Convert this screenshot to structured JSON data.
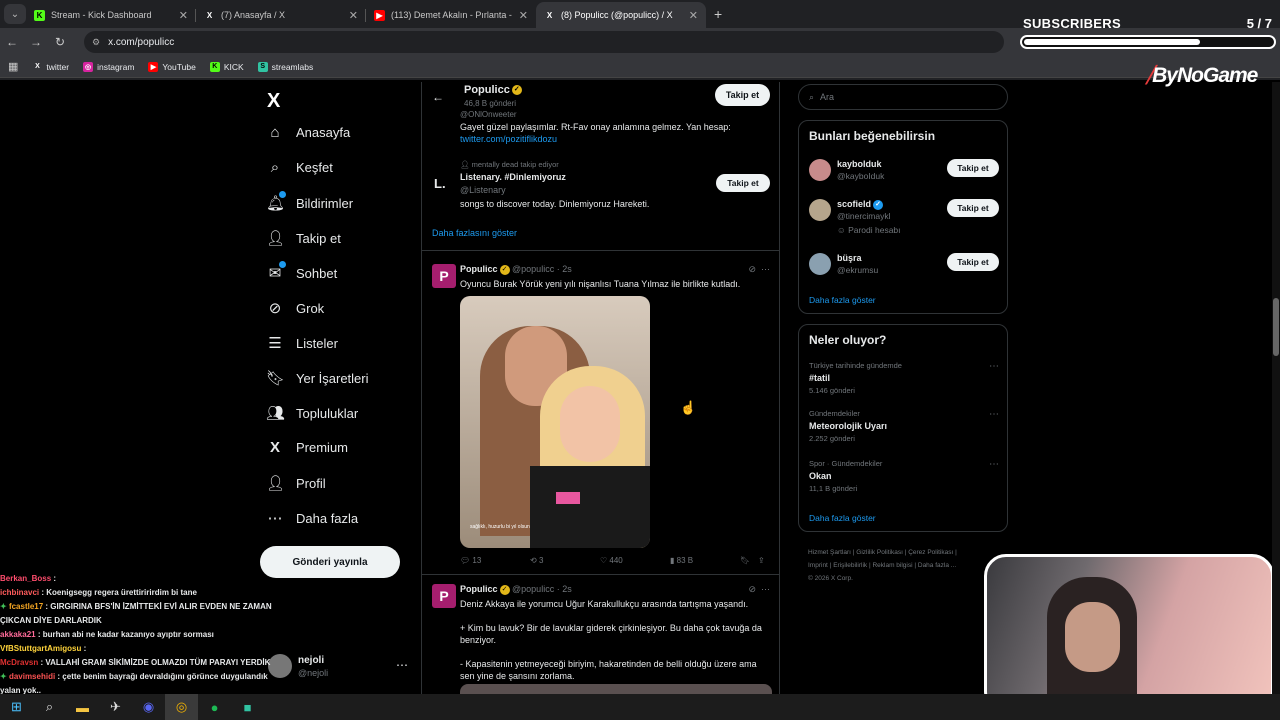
{
  "browser": {
    "tabs": [
      {
        "title": "Stream - Kick Dashboard",
        "icon": "kick-icon"
      },
      {
        "title": "(7) Anasayfa / X",
        "icon": "x-icon"
      },
      {
        "title": "(113) Demet Akalın - Pırlanta -",
        "icon": "youtube-icon"
      },
      {
        "title": "(8) Populicc (@populicc) / X",
        "icon": "x-icon",
        "active": true
      }
    ],
    "url": "x.com/populicc",
    "bookmarks": [
      "twitter",
      "instagram",
      "YouTube",
      "KICK",
      "streamlabs"
    ]
  },
  "overlay": {
    "subscribers_label": "SUBSCRIBERS",
    "subscribers_count": "5 / 7",
    "subscribers_progress": 0.71,
    "brand": "ByNoGame"
  },
  "sidebar": {
    "logo": "X",
    "items": [
      {
        "label": "Anasayfa",
        "icon": "home-icon"
      },
      {
        "label": "Keşfet",
        "icon": "search-icon"
      },
      {
        "label": "Bildirimler",
        "icon": "bell-icon"
      },
      {
        "label": "Takip et",
        "icon": "follow-icon"
      },
      {
        "label": "Sohbet",
        "icon": "mail-icon"
      },
      {
        "label": "Grok",
        "icon": "grok-icon"
      },
      {
        "label": "Listeler",
        "icon": "list-icon"
      },
      {
        "label": "Yer İşaretleri",
        "icon": "bookmark-icon"
      },
      {
        "label": "Topluluklar",
        "icon": "communities-icon"
      },
      {
        "label": "Premium",
        "icon": "x-icon"
      },
      {
        "label": "Profil",
        "icon": "profile-icon"
      },
      {
        "label": "Daha fazla",
        "icon": "more-icon"
      }
    ],
    "post_button": "Gönderi yayınla",
    "account": {
      "name": "nejoli",
      "handle": "@nejoli"
    }
  },
  "chat": [
    {
      "user": "Berkan_Boss",
      "text": ":",
      "color": "#ff4d6d"
    },
    {
      "user": "ichbinavci",
      "text": ": Koenigsegg regera ürettiririrdim bi tane",
      "color": "#ff5c5c"
    },
    {
      "user": "fcastle17",
      "text": ": GIRGIRINA BFS'İN İZMİTTEKİ EVİ ALIR EVDEN NE ZAMAN ÇIKCAN DİYE DARLARDIK",
      "color": "#f5a623"
    },
    {
      "user": "akkaka21",
      "text": ": burhan abi ne kadar kazanıyo ayıptır sorması",
      "color": "#ff6b9a"
    },
    {
      "user": "VfBStuttgartAmigosu",
      "text": ":",
      "color": "#ffd43b"
    },
    {
      "user": "McDravsn",
      "text": ": VALLAHİ GRAM SİKİMİZDE OLMAZDI TÜM PARAYI YERDİK",
      "color": "#e03131"
    },
    {
      "user": "davimsehidi",
      "text": ": çette benim bayrağı devraldığını görünce duygulandık yalan yok..",
      "color": "#fa5252"
    }
  ],
  "profile_header": {
    "name": "Populicc",
    "posts": "46,8 B gönderi",
    "follow_label": "Takip et"
  },
  "suggestions_top": {
    "partial_handle": "@ONlOnweeter",
    "bio": "Gayet güzel paylaşımlar. Rt-Fav onay anlamına gelmez. Yan hesap:",
    "bio_link": "twitter.com/pozitiflikdozu",
    "social_context": "mentally dead takip ediyor",
    "name": "Listenary. #Dinlemiyoruz",
    "handle": "@Listenary",
    "desc": "songs to discover today. Dinlemiyoruz Hareketi.",
    "follow_label": "Takip et",
    "show_more": "Daha fazlasını göster"
  },
  "tweets": [
    {
      "name": "Populicc",
      "handle": "@populicc",
      "time": "2s",
      "text": "Oyuncu Burak Yörük yeni yılı nişanlısı Tuana Yılmaz ile birlikte kutladı.",
      "photo_caption": "sağlıklı, huzurlu bi yıl olsun",
      "replies": "13",
      "retweets": "3",
      "likes": "440",
      "views": "83 B"
    },
    {
      "name": "Populicc",
      "handle": "@populicc",
      "time": "2s",
      "text1": "Deniz Akkaya ile yorumcu Uğur Karakullukçu arasında tartışma yaşandı.",
      "text2": "+ Kim bu lavuk? Bir de lavuklar giderek çirkinleşiyor. Bu daha çok tavuğa da benziyor.",
      "text3": "- Kapasitenin yetmeyeceği biriyim, hakaretinden de belli olduğu üzere ama sen yine de şansını zorlama."
    }
  ],
  "right": {
    "search_placeholder": "Ara",
    "who_title": "Bunları beğenebilirsin",
    "who": [
      {
        "name": "kaybolduk",
        "handle": "@kayboIduk",
        "follow": "Takip et"
      },
      {
        "name": "scofield",
        "handle": "@tinercimaykl",
        "note": "Parodi hesabı",
        "follow": "Takip et"
      },
      {
        "name": "büşra",
        "handle": "@ekrumsu",
        "follow": "Takip et"
      }
    ],
    "who_more": "Daha fazla göster",
    "trends_title": "Neler oluyor?",
    "trends": [
      {
        "context": "Türkiye tarihinde gündemde",
        "name": "#tatil",
        "count": "5.146 gönderi"
      },
      {
        "context": "Gündemdekiler",
        "name": "Meteorolojik Uyarı",
        "count": "2.252 gönderi"
      },
      {
        "context": "Spor · Gündemdekiler",
        "name": "Okan",
        "count": "11,1 B gönderi"
      }
    ],
    "trends_more": "Daha fazla göster",
    "footer": [
      "Hizmet Şartları",
      "Gizlilik Politikası",
      "Çerez Politikası",
      "Imprint",
      "Erişilebilirlik",
      "Reklam bilgisi",
      "Daha fazla ...",
      "© 2026 X Corp."
    ]
  }
}
